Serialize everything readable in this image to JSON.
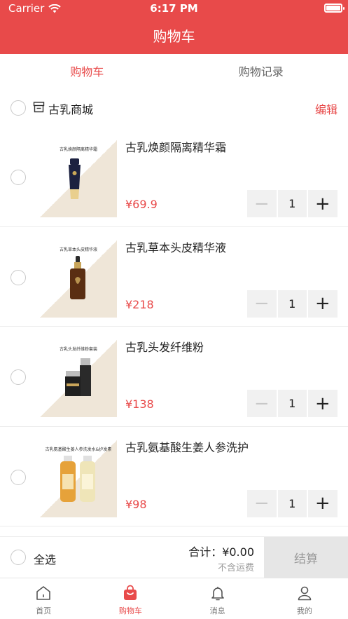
{
  "status": {
    "carrier": "Carrier",
    "time": "6:17 PM"
  },
  "nav": {
    "title": "购物车"
  },
  "segments": [
    {
      "label": "购物车",
      "active": true
    },
    {
      "label": "购物记录",
      "active": false
    }
  ],
  "store": {
    "name": "古乳商城",
    "edit_label": "编辑"
  },
  "items": [
    {
      "caption": "古乳焕颜隔离精华霜",
      "title": "古乳焕颜隔离精华霜",
      "price": "¥69.9",
      "qty": "1"
    },
    {
      "caption": "古乳草本头皮精华液",
      "title": "古乳草本头皮精华液",
      "price": "¥218",
      "qty": "1"
    },
    {
      "caption": "古乳头发纤维粉套装",
      "title": "古乳头发纤维粉",
      "price": "¥138",
      "qty": "1"
    },
    {
      "caption": "古乳氨基酸生姜人参洗发水&护发素",
      "title": "古乳氨基酸生姜人参洗护",
      "price": "¥98",
      "qty": "1"
    }
  ],
  "stepper": {
    "minus": "−",
    "plus": "+"
  },
  "summary": {
    "select_all": "全选",
    "total": "合计：¥0.00",
    "shipping_note": "不含运费",
    "checkout": "结算"
  },
  "tabbar": [
    {
      "label": "首页",
      "icon": "home-icon",
      "active": false
    },
    {
      "label": "购物车",
      "icon": "cart-bag-icon",
      "active": true
    },
    {
      "label": "消息",
      "icon": "bell-icon",
      "active": false
    },
    {
      "label": "我的",
      "icon": "person-icon",
      "active": false
    }
  ],
  "colors": {
    "accent": "#e84a4a",
    "checkout_bg": "#e6e6e6",
    "stepper_bg": "#f1f1f1"
  }
}
